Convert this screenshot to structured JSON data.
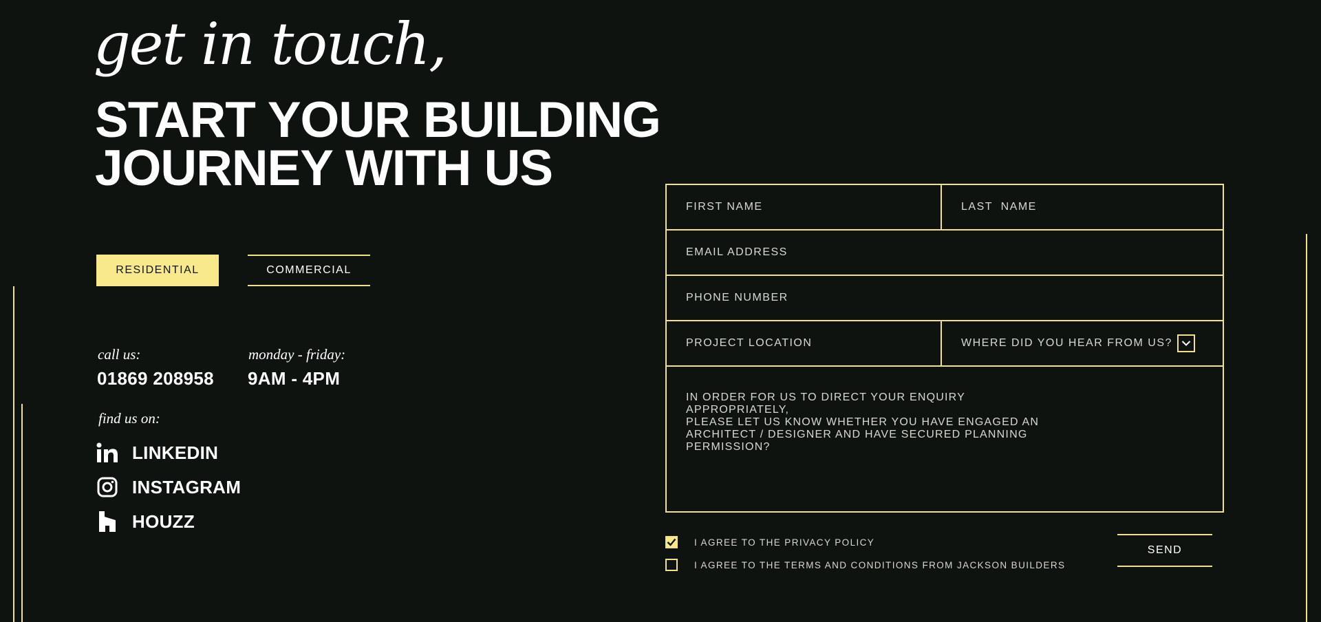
{
  "hero": {
    "script_title": "get in touch,",
    "headline_line1": "START YOUR BUILDING",
    "headline_line2": "JOURNEY WITH US"
  },
  "segment": {
    "residential_label": "RESIDENTIAL",
    "commercial_label": "COMMERCIAL",
    "selected": "RESIDENTIAL"
  },
  "contact": {
    "call_label": "call us:",
    "phone": "01869 208958",
    "hours_label": "monday - friday:",
    "hours": "9AM - 4PM",
    "find_label": "find us on:"
  },
  "social": [
    {
      "label": "LINKEDIN",
      "icon": "linkedin-icon"
    },
    {
      "label": "INSTAGRAM",
      "icon": "instagram-icon"
    },
    {
      "label": "HOUZZ",
      "icon": "houzz-icon"
    }
  ],
  "form": {
    "first_name_placeholder": "FIRST NAME",
    "last_name_placeholder": "LAST  NAME",
    "email_placeholder": "EMAIL ADDRESS",
    "phone_placeholder": "PHONE NUMBER",
    "location_placeholder": "PROJECT LOCATION",
    "hear_select": "WHERE DID YOU HEAR FROM US?",
    "message_line1": "IN ORDER FOR US TO DIRECT YOUR ENQUIRY APPROPRIATELY,",
    "message_line2": "PLEASE LET US KNOW WHETHER YOU HAVE ENGAGED AN",
    "message_line3": "ARCHITECT / DESIGNER AND HAVE SECURED PLANNING",
    "message_line4": "PERMISSION?",
    "privacy_label": "I AGREE TO THE PRIVACY POLICY",
    "privacy_checked": true,
    "terms_label": "I AGREE TO THE TERMS AND CONDITIONS FROM JACKSON BUILDERS",
    "terms_checked": false,
    "send_label": "SEND"
  },
  "colors": {
    "background": "#0f130f",
    "accent": "#f8e98a",
    "text": "#ffffff"
  }
}
